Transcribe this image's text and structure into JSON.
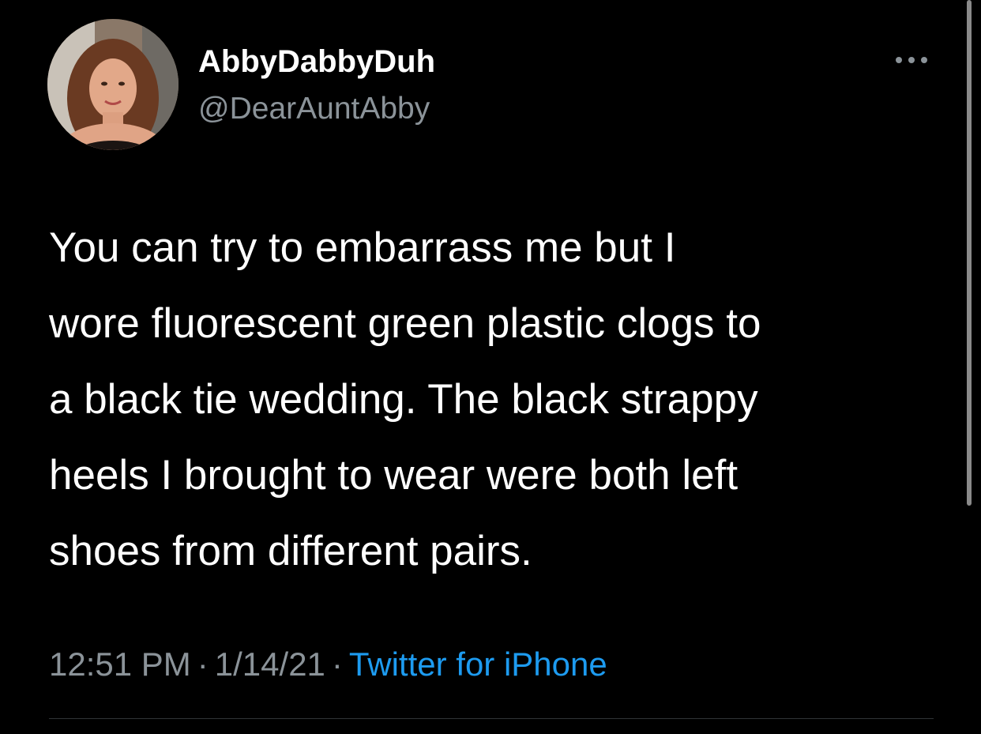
{
  "author": {
    "display_name": "AbbyDabbyDuh",
    "handle": "@DearAuntAbby"
  },
  "tweet": {
    "text_lines": [
      "You can try to embarrass me but I",
      "wore fluorescent green plastic clogs to",
      "a black tie wedding.  The black strappy",
      "heels I brought to wear were both left",
      "shoes from different pairs."
    ],
    "time": "12:51 PM",
    "date": "1/14/21",
    "separator": "·",
    "source": "Twitter for iPhone"
  },
  "icons": {
    "more": "more-horizontal-icon",
    "avatar": "avatar-photo"
  },
  "colors": {
    "background": "#000000",
    "primary_text": "#ffffff",
    "secondary_text": "#8b9399",
    "link": "#1d9bf0",
    "divider": "#2f3336"
  }
}
